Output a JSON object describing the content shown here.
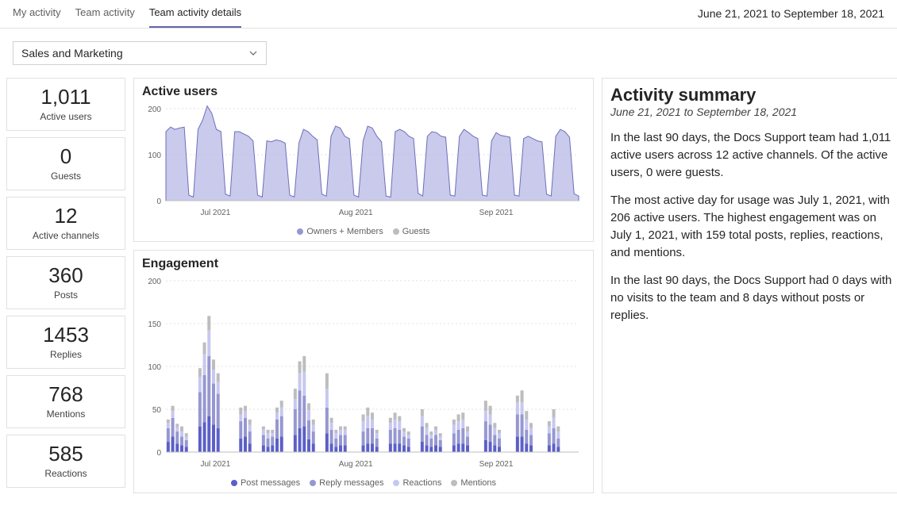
{
  "tabs": {
    "my_activity": "My activity",
    "team_activity": "Team activity",
    "team_activity_details": "Team activity details"
  },
  "date_range_label": "June 21, 2021 to September 18, 2021",
  "team_select": {
    "value": "Sales and Marketing"
  },
  "stats": {
    "active_users": {
      "value": "1,011",
      "label": "Active users"
    },
    "guests": {
      "value": "0",
      "label": "Guests"
    },
    "active_channels": {
      "value": "12",
      "label": "Active channels"
    },
    "posts": {
      "value": "360",
      "label": "Posts"
    },
    "replies": {
      "value": "1453",
      "label": "Replies"
    },
    "mentions": {
      "value": "768",
      "label": "Mentions"
    },
    "reactions": {
      "value": "585",
      "label": "Reactions"
    }
  },
  "chart1": {
    "title": "Active users",
    "legend": {
      "a": "Owners + Members",
      "b": "Guests"
    },
    "colors": {
      "a": "#9697d1",
      "b": "#bdbdbd"
    }
  },
  "chart2": {
    "title": "Engagement",
    "legend": {
      "a": "Post messages",
      "b": "Reply messages",
      "c": "Reactions",
      "d": "Mentions"
    },
    "colors": {
      "a": "#5b5fc7",
      "b": "#9697d1",
      "c": "#c7c8f0",
      "d": "#bdbdbd"
    }
  },
  "summary": {
    "title": "Activity summary",
    "subtitle": "June 21, 2021 to September 18, 2021",
    "p1": "In the last 90 days, the Docs Support team had 1,011 active users across 12 active channels. Of the active users, 0 were guests.",
    "p2": "The most active day for usage was July 1, 2021, with 206 active users. The highest engagement was on July 1, 2021, with 159 total posts, replies, reactions, and mentions.",
    "p3": "In the last 90 days, the Docs Support had 0 days with no visits to the team and 8 days without posts or replies."
  },
  "chart_data": [
    {
      "type": "area",
      "title": "Active users",
      "ylabel": "",
      "xlabel": "",
      "ylim": [
        0,
        200
      ],
      "y_ticks": [
        0,
        100,
        200
      ],
      "x_ticks": [
        "Jul 2021",
        "Aug 2021",
        "Sep 2021"
      ],
      "series": [
        {
          "name": "Owners + Members",
          "values": [
            150,
            160,
            155,
            158,
            160,
            12,
            8,
            155,
            175,
            206,
            190,
            155,
            150,
            14,
            10,
            150,
            150,
            145,
            140,
            130,
            12,
            8,
            130,
            128,
            132,
            130,
            125,
            12,
            8,
            125,
            155,
            150,
            140,
            132,
            14,
            10,
            140,
            162,
            158,
            140,
            135,
            12,
            8,
            130,
            162,
            158,
            140,
            128,
            10,
            8,
            150,
            155,
            150,
            140,
            135,
            16,
            10,
            140,
            150,
            148,
            140,
            138,
            12,
            10,
            140,
            155,
            148,
            140,
            135,
            12,
            10,
            130,
            148,
            142,
            140,
            138,
            12,
            10,
            135,
            140,
            135,
            130,
            128,
            14,
            10,
            140,
            155,
            150,
            138,
            15,
            10
          ]
        },
        {
          "name": "Guests",
          "values": []
        }
      ]
    },
    {
      "type": "bar",
      "title": "Engagement",
      "ylabel": "",
      "xlabel": "",
      "ylim": [
        0,
        200
      ],
      "y_ticks": [
        0,
        50,
        100,
        150,
        200
      ],
      "x_ticks": [
        "Jul 2021",
        "Aug 2021",
        "Sep 2021"
      ],
      "stacked": true,
      "series": [
        {
          "name": "Post messages",
          "values": [
            12,
            18,
            10,
            8,
            6,
            0,
            0,
            30,
            35,
            42,
            32,
            28,
            0,
            0,
            0,
            0,
            16,
            18,
            10,
            0,
            0,
            8,
            6,
            8,
            16,
            18,
            0,
            0,
            20,
            28,
            30,
            15,
            10,
            0,
            0,
            22,
            10,
            6,
            8,
            8,
            0,
            0,
            0,
            8,
            10,
            10,
            6,
            0,
            0,
            10,
            10,
            10,
            8,
            6,
            0,
            0,
            12,
            8,
            6,
            8,
            6,
            0,
            0,
            8,
            10,
            10,
            8,
            0,
            0,
            0,
            14,
            12,
            8,
            6,
            0,
            0,
            0,
            18,
            18,
            10,
            8,
            0,
            0,
            0,
            8,
            10,
            6,
            0,
            0,
            0,
            0
          ]
        },
        {
          "name": "Reply messages",
          "values": [
            16,
            22,
            14,
            10,
            8,
            0,
            0,
            40,
            55,
            70,
            48,
            40,
            0,
            0,
            0,
            0,
            20,
            22,
            14,
            0,
            0,
            12,
            10,
            10,
            22,
            24,
            0,
            0,
            30,
            44,
            36,
            22,
            14,
            0,
            0,
            30,
            16,
            10,
            12,
            12,
            0,
            0,
            0,
            16,
            18,
            18,
            10,
            0,
            0,
            16,
            18,
            16,
            10,
            10,
            0,
            0,
            18,
            12,
            10,
            12,
            8,
            0,
            0,
            14,
            16,
            18,
            10,
            0,
            0,
            0,
            22,
            20,
            12,
            10,
            0,
            0,
            0,
            26,
            26,
            16,
            12,
            0,
            0,
            0,
            14,
            18,
            10,
            0,
            0,
            0,
            0
          ]
        },
        {
          "name": "Reactions",
          "values": [
            6,
            8,
            5,
            6,
            4,
            0,
            0,
            18,
            24,
            30,
            16,
            14,
            0,
            0,
            0,
            0,
            8,
            8,
            8,
            0,
            0,
            6,
            6,
            4,
            8,
            10,
            0,
            0,
            12,
            20,
            28,
            12,
            8,
            0,
            0,
            22,
            8,
            6,
            6,
            6,
            0,
            0,
            0,
            12,
            14,
            10,
            6,
            0,
            0,
            8,
            10,
            10,
            6,
            4,
            0,
            0,
            12,
            8,
            4,
            6,
            4,
            0,
            0,
            10,
            10,
            10,
            6,
            0,
            0,
            0,
            12,
            12,
            8,
            6,
            0,
            0,
            0,
            14,
            14,
            12,
            8,
            0,
            0,
            0,
            8,
            12,
            8,
            0,
            0,
            0,
            0
          ]
        },
        {
          "name": "Mentions",
          "values": [
            4,
            6,
            4,
            6,
            4,
            0,
            0,
            10,
            14,
            17,
            12,
            10,
            0,
            0,
            0,
            0,
            8,
            6,
            6,
            0,
            0,
            4,
            4,
            4,
            6,
            8,
            0,
            0,
            12,
            14,
            18,
            8,
            6,
            0,
            0,
            18,
            6,
            4,
            4,
            4,
            0,
            0,
            0,
            8,
            10,
            8,
            4,
            0,
            0,
            6,
            8,
            6,
            4,
            4,
            0,
            0,
            8,
            6,
            4,
            4,
            4,
            0,
            0,
            6,
            8,
            8,
            6,
            0,
            0,
            0,
            12,
            10,
            6,
            4,
            0,
            0,
            0,
            8,
            14,
            10,
            6,
            0,
            0,
            0,
            6,
            10,
            6,
            0,
            0,
            0,
            0
          ]
        }
      ]
    }
  ]
}
